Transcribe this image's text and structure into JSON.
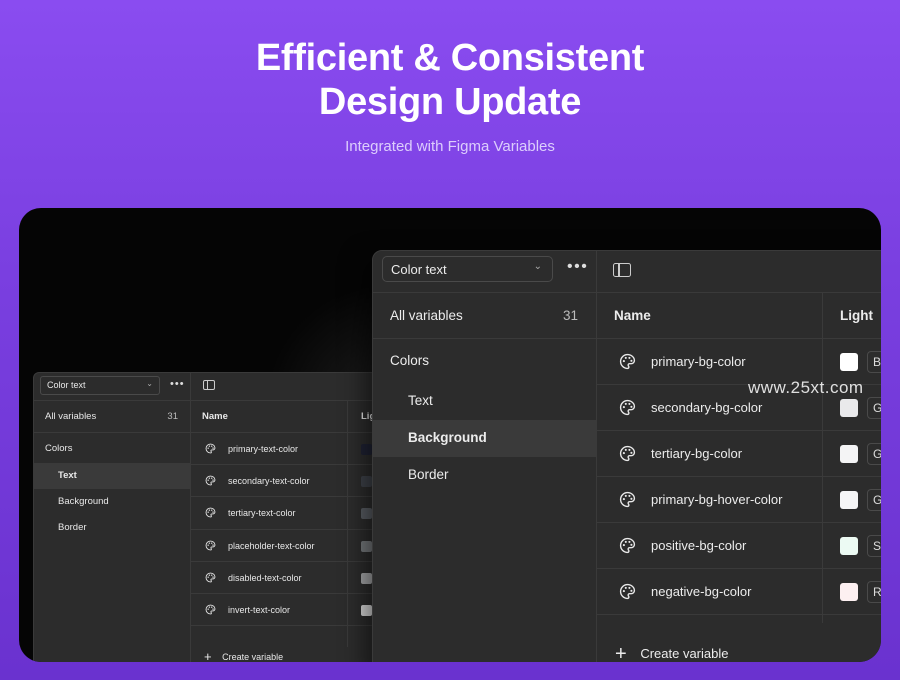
{
  "hero": {
    "title_line1": "Efficient & Consistent",
    "title_line2": "Design Update",
    "subtitle": "Integrated with Figma Variables"
  },
  "small_panel": {
    "collection": "Color text",
    "all_variables_label": "All variables",
    "all_variables_count": "31",
    "group": "Colors",
    "groups": [
      {
        "label": "Text",
        "active": true
      },
      {
        "label": "Background",
        "active": false
      },
      {
        "label": "Border",
        "active": false
      }
    ],
    "col_name": "Name",
    "col_mode": "Lig",
    "rows": [
      {
        "name": "primary-text-color",
        "swatch": "#1f2233"
      },
      {
        "name": "secondary-text-color",
        "swatch": "#3e4249"
      },
      {
        "name": "tertiary-text-color",
        "swatch": "#595d63"
      },
      {
        "name": "placeholder-text-color",
        "swatch": "#76797d"
      },
      {
        "name": "disabled-text-color",
        "swatch": "#a7a8aa"
      },
      {
        "name": "invert-text-color",
        "swatch": "#d9d9d9"
      }
    ],
    "create_label": "Create variable"
  },
  "large_panel": {
    "collection": "Color text",
    "all_variables_label": "All variables",
    "all_variables_count": "31",
    "group": "Colors",
    "groups": [
      {
        "label": "Text",
        "active": false
      },
      {
        "label": "Background",
        "active": true
      },
      {
        "label": "Border",
        "active": false
      }
    ],
    "col_name": "Name",
    "col_mode": "Light",
    "rows": [
      {
        "name": "primary-bg-color",
        "swatch": "#ffffff",
        "tag": "Ba"
      },
      {
        "name": "secondary-bg-color",
        "swatch": "#e9e9eb",
        "tag": "G"
      },
      {
        "name": "tertiary-bg-color",
        "swatch": "#f4f4f5",
        "tag": "G"
      },
      {
        "name": "primary-bg-hover-color",
        "swatch": "#f6f6f7",
        "tag": "G"
      },
      {
        "name": "positive-bg-color",
        "swatch": "#ecfaf3",
        "tag": "Sc"
      },
      {
        "name": "negative-bg-color",
        "swatch": "#fdf0f1",
        "tag": "Re"
      }
    ],
    "create_label": "Create variable"
  },
  "watermark": "www.25xt.com"
}
